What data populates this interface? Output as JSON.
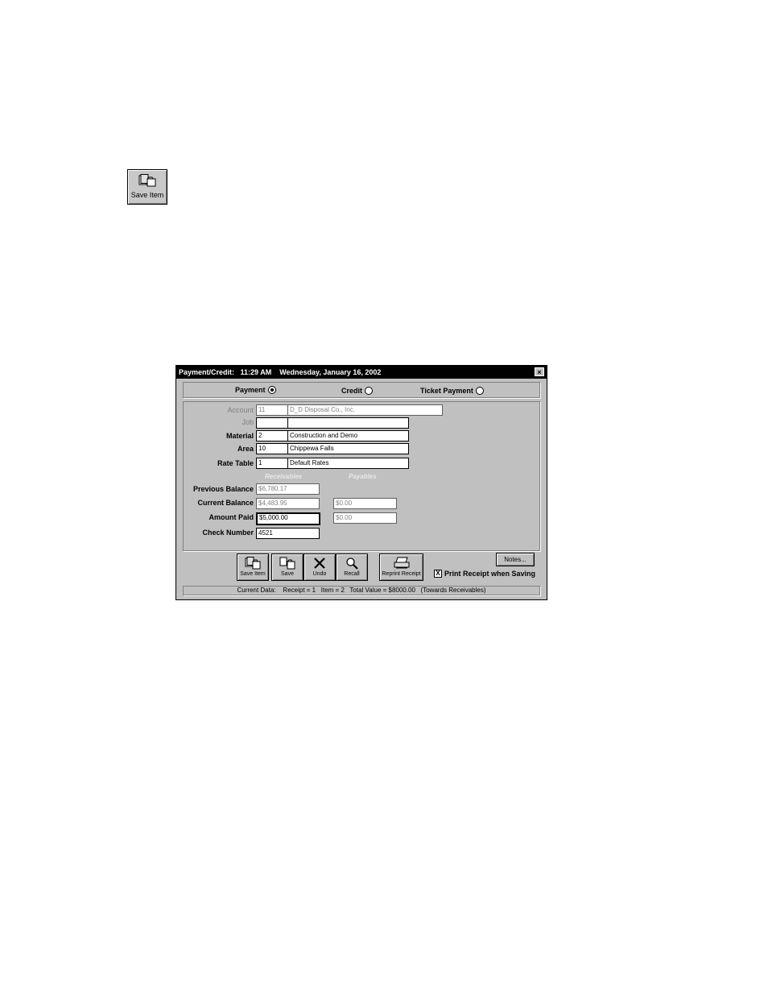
{
  "standalone_button": {
    "label": "Save Item",
    "icon": "save-item-icon"
  },
  "dialog": {
    "title": "Payment/Credit:   11:29 AM    Wednesday, January 16, 2002",
    "close_label": "×",
    "radios": [
      {
        "label": "Payment",
        "selected": true
      },
      {
        "label": "Credit",
        "selected": false
      },
      {
        "label": "Ticket Payment",
        "selected": false
      }
    ],
    "fields": {
      "account": {
        "label": "Account",
        "code": "11",
        "name": "D_D Disposal Co., Inc."
      },
      "job": {
        "label": "Job",
        "code": "",
        "name": ""
      },
      "material": {
        "label": "Material",
        "code": "2",
        "name": "Construction and Demo"
      },
      "area": {
        "label": "Area",
        "code": "10",
        "name": "Chippewa Falls"
      },
      "rate_table": {
        "label": "Rate Table",
        "code": "1",
        "name": "Default Rates"
      }
    },
    "columns": {
      "receivables": "Receivables",
      "payables": "Payables"
    },
    "balances": {
      "previous": {
        "label": "Previous Balance",
        "receivables": "$6,780.17"
      },
      "current": {
        "label": "Current Balance",
        "receivables": "$4,483.95",
        "payables": "$0.00"
      },
      "amount_paid": {
        "label": "Amount Paid",
        "receivables": "$5,000.00",
        "payables": "$0.00"
      },
      "check_number": {
        "label": "Check Number",
        "value": "4521"
      }
    },
    "toolbar": [
      {
        "label": "Save Item",
        "icon": "save-item-icon"
      },
      {
        "label": "Save",
        "icon": "save-icon"
      },
      {
        "label": "Undo",
        "icon": "undo-x-icon"
      },
      {
        "label": "Recall",
        "icon": "magnifier-icon"
      },
      {
        "label": "Reprint Receipt",
        "icon": "printer-icon"
      }
    ],
    "notes_label": "Notes...",
    "print_receipt": {
      "label": "Print Receipt when Saving",
      "checked": true,
      "mark": "X"
    },
    "status": "Current Data:    Receipt = 1   Item = 2   Total Value = $8000.00   (Towards Receivables)"
  }
}
